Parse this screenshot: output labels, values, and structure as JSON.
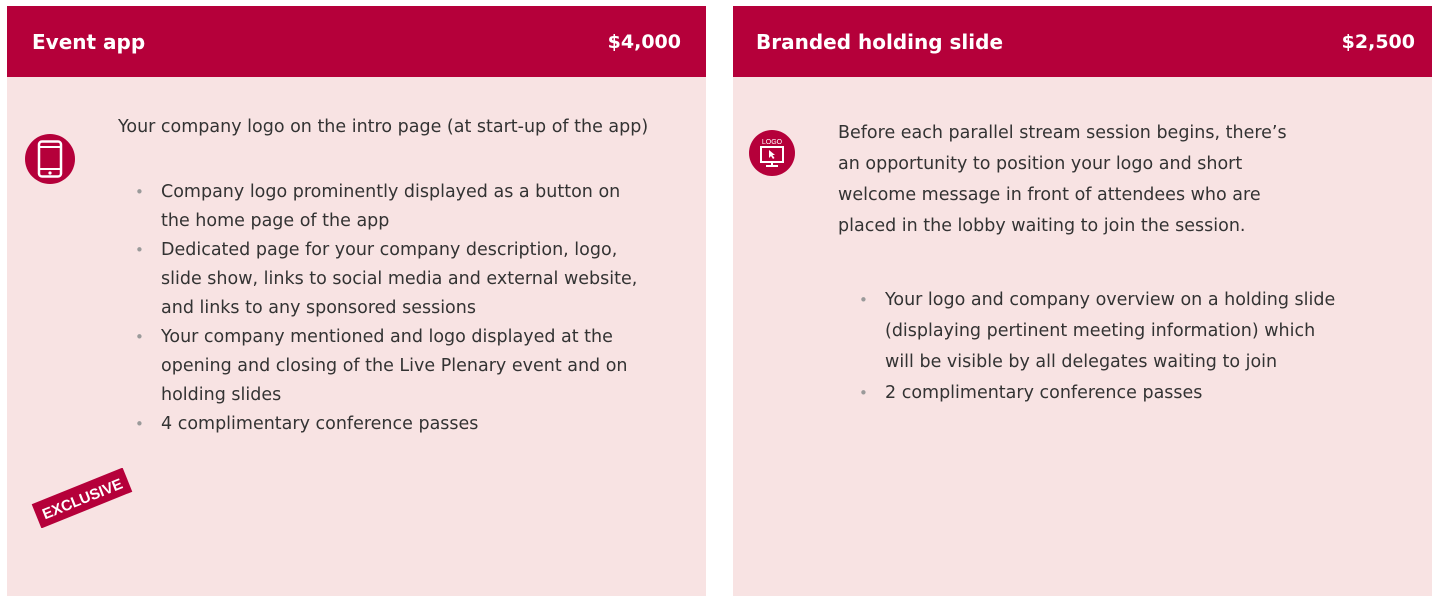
{
  "cards": [
    {
      "title": "Event app",
      "price": "$4,000",
      "icon": "smartphone-icon",
      "intro": "Your company logo on the intro page (at start-up of the app)",
      "bullets": [
        "Company logo prominently displayed as a button on the home page of the app",
        "Dedicated page for your company description, logo, slide show, links to social media and external website, and links to any sponsored sessions",
        "Your company mentioned and logo displayed at the opening and closing of the Live Plenary event and on holding slides",
        "4 complimentary conference passes"
      ],
      "badge": "EXCLUSIVE"
    },
    {
      "title": "Branded holding slide",
      "price": "$2,500",
      "icon": "logo-monitor-icon",
      "icon_text": "LOGO",
      "intro": "Before each parallel stream session begins, there’s an opportunity to position your logo and short welcome message in front of attendees who are placed in the lobby waiting to join the session.",
      "bullets": [
        "Your logo and company overview on a holding slide (displaying pertinent meeting information) which will be visible by all delegates waiting to join",
        "2 complimentary conference passes"
      ]
    }
  ],
  "colors": {
    "header": "#b5003a",
    "card_background": "#f8e3e3",
    "text": "#333333"
  }
}
